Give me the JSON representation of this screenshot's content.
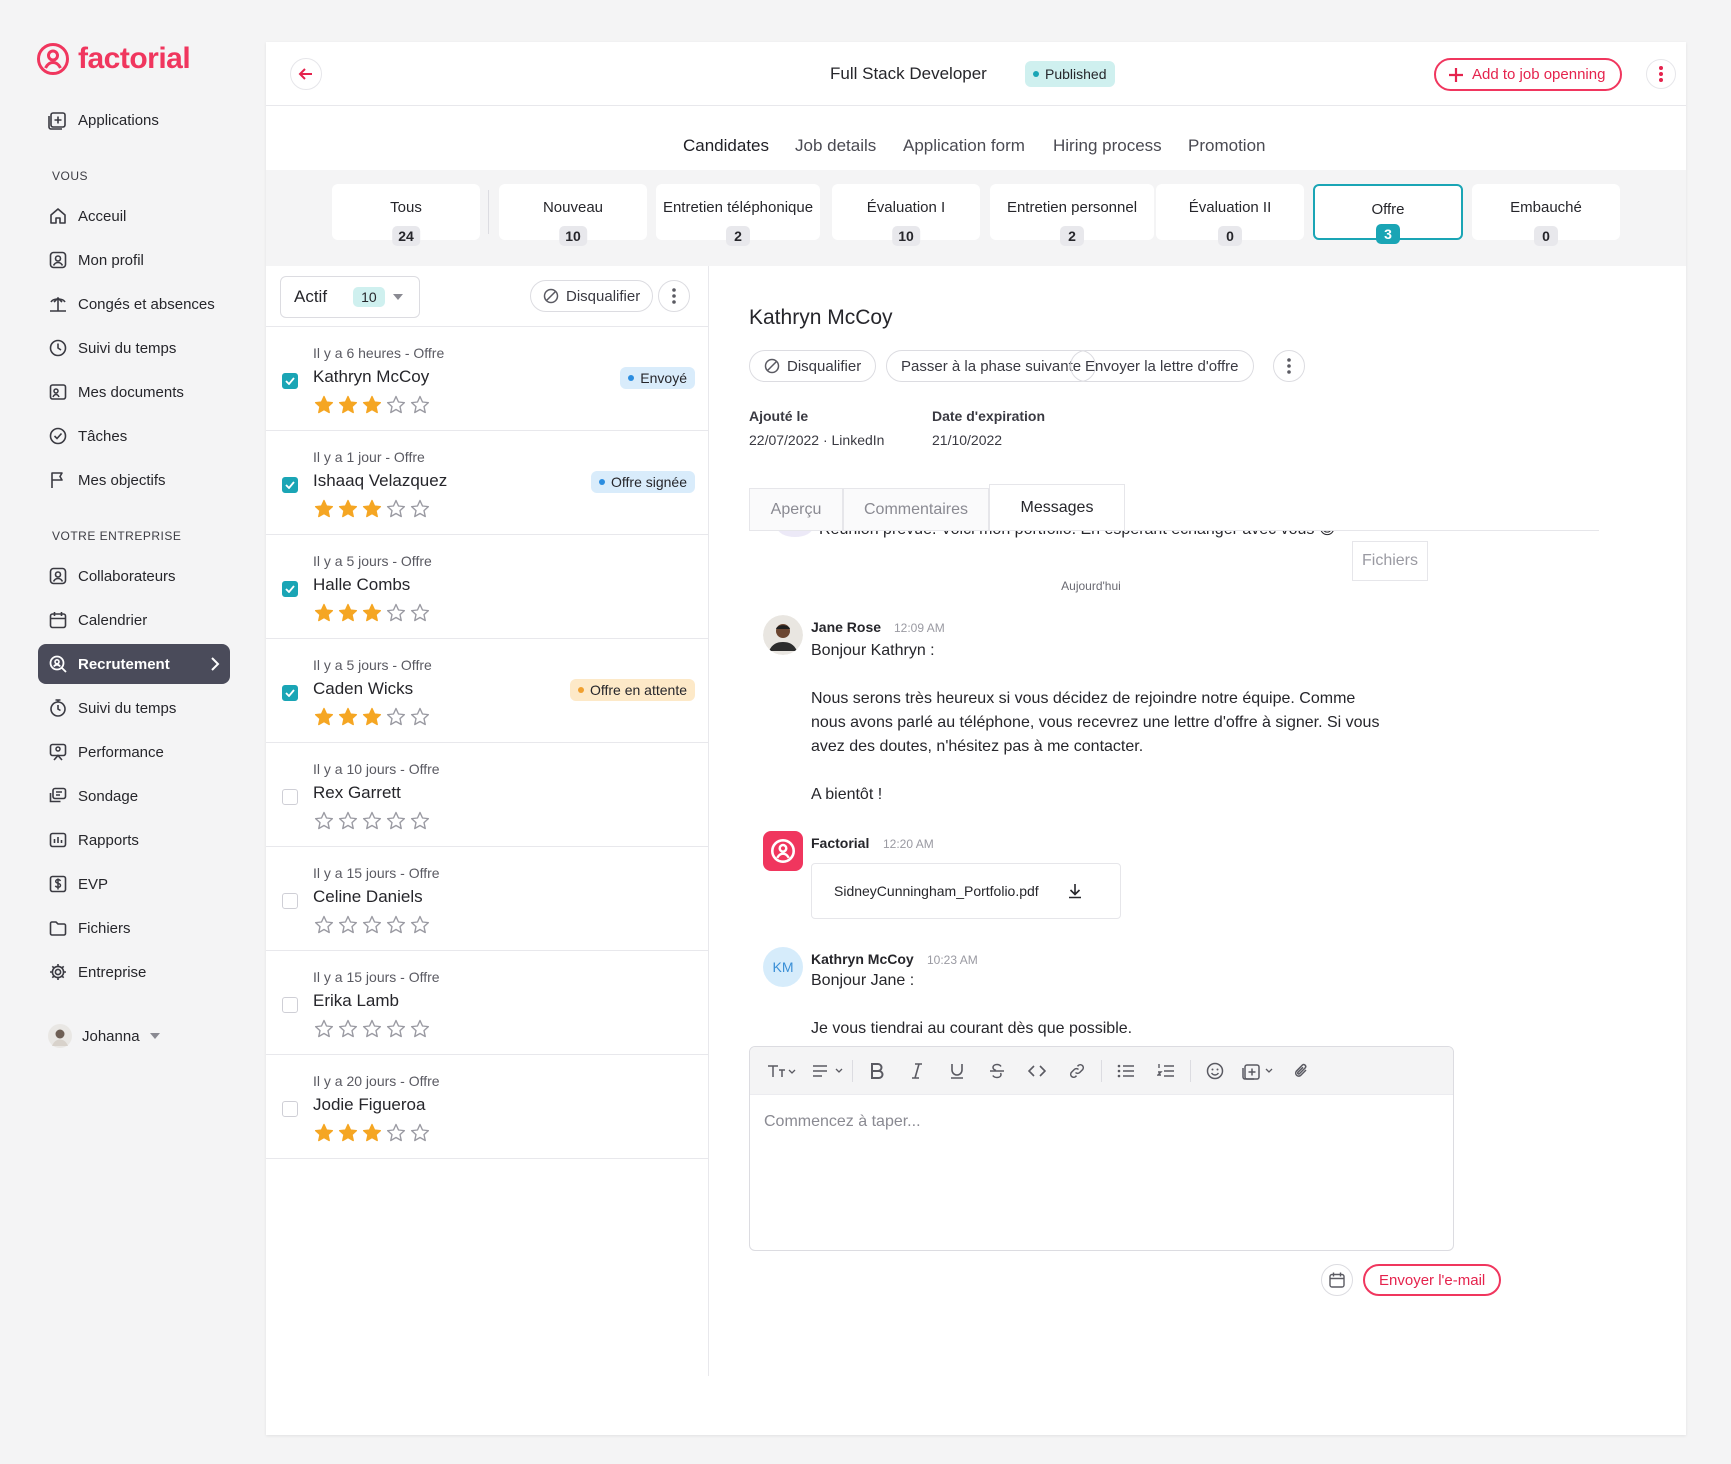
{
  "brand": {
    "name": "factorial",
    "color": "#f0365e"
  },
  "sidebar": {
    "top_item": {
      "label": "Applications",
      "icon": "applications-icon"
    },
    "section_you": "VOUS",
    "you_items": [
      {
        "label": "Acceuil",
        "icon": "home-icon"
      },
      {
        "label": "Mon profil",
        "icon": "profile-icon"
      },
      {
        "label": "Congés et absences",
        "icon": "vacation-icon"
      },
      {
        "label": "Suivi du temps",
        "icon": "clock-icon"
      },
      {
        "label": "Mes documents",
        "icon": "documents-icon"
      },
      {
        "label": "Tâches",
        "icon": "tasks-icon"
      },
      {
        "label": "Mes objectifs",
        "icon": "flag-icon"
      }
    ],
    "section_company": "VOTRE ENTREPRISE",
    "company_items": [
      {
        "label": "Collaborateurs",
        "icon": "employees-icon"
      },
      {
        "label": "Calendrier",
        "icon": "calendar-icon"
      },
      {
        "label": "Recrutement",
        "icon": "recruitment-icon",
        "active": true
      },
      {
        "label": "Suivi du temps",
        "icon": "timer-icon"
      },
      {
        "label": "Performance",
        "icon": "performance-icon"
      },
      {
        "label": "Sondage",
        "icon": "survey-icon"
      },
      {
        "label": "Rapports",
        "icon": "reports-icon"
      },
      {
        "label": "EVP",
        "icon": "payroll-icon"
      },
      {
        "label": "Fichiers",
        "icon": "folder-icon"
      },
      {
        "label": "Entreprise",
        "icon": "gear-icon"
      }
    ],
    "user": {
      "name": "Johanna"
    }
  },
  "header": {
    "job_title": "Full Stack Developer",
    "status": "Published",
    "add_button": "Add to job openning"
  },
  "tabs": [
    "Candidates",
    "Job details",
    "Application form",
    "Hiring process",
    "Promotion"
  ],
  "stages": [
    {
      "name": "Tous",
      "count": "24"
    },
    {
      "name": "Nouveau",
      "count": "10"
    },
    {
      "name": "Entretien téléphonique",
      "count": "2"
    },
    {
      "name": "Évaluation I",
      "count": "10"
    },
    {
      "name": "Entretien personnel",
      "count": "2"
    },
    {
      "name": "Évaluation II",
      "count": "0"
    },
    {
      "name": "Offre",
      "count": "3",
      "selected": true
    },
    {
      "name": "Embauché",
      "count": "0"
    }
  ],
  "list": {
    "filter_label": "Actif",
    "filter_count": "10",
    "disqualify": "Disqualifier",
    "candidates": [
      {
        "meta": "Il y a 6 heures - Offre",
        "name": "Kathryn McCoy",
        "checked": true,
        "rating": 3,
        "badge": "Envoyé",
        "badge_color": "#d9ecfb",
        "dot_color": "#2b8de0"
      },
      {
        "meta": "Il y a 1 jour  - Offre",
        "name": "Ishaaq Velazquez",
        "checked": true,
        "rating": 3,
        "badge": "Offre signée",
        "badge_color": "#d9ecfb",
        "dot_color": "#2b8de0"
      },
      {
        "meta": "Il y a 5 jours  - Offre",
        "name": "Halle Combs",
        "checked": true,
        "rating": 3
      },
      {
        "meta": "Il y a 5 jours  - Offre",
        "name": "Caden Wicks",
        "checked": true,
        "rating": 3,
        "badge": "Offre en attente",
        "badge_color": "#fde9c8",
        "dot_color": "#f0a030"
      },
      {
        "meta": "Il y a 10 jours  - Offre",
        "name": "Rex Garrett",
        "checked": false,
        "rating": 0
      },
      {
        "meta": "Il y a 15 jours  - Offre",
        "name": "Celine Daniels",
        "checked": false,
        "rating": 0
      },
      {
        "meta": "Il y a 15 jours  - Offre",
        "name": "Erika Lamb",
        "checked": false,
        "rating": 0
      },
      {
        "meta": "Il y a 20 jours  - Offre",
        "name": "Jodie Figueroa",
        "checked": false,
        "rating": 3
      }
    ]
  },
  "detail": {
    "name": "Kathryn McCoy",
    "actions": [
      "Disqualifier",
      "Passer à la phase suivante",
      "Envoyer la lettre d'offre"
    ],
    "added_label": "Ajouté le",
    "added_value": "22/07/2022 · LinkedIn",
    "expiry_label": "Date d'expiration",
    "expiry_value": "21/10/2022",
    "tabs": [
      "Aperçu",
      "Commentaires",
      "Messages"
    ],
    "cut_message": "Réunion prévue. Voici mon portfolio. En espérant échanger avec vous 😊",
    "files_tab": "Fichiers",
    "today": "Aujourd'hui",
    "messages": [
      {
        "sender": "Jane Rose",
        "time": "12:09 AM",
        "text": "Bonjour Kathryn :\n\nNous serons très heureux si vous décidez de rejoindre notre équipe. Comme nous avons parlé au téléphone, vous recevrez une lettre d'offre à signer. Si vous avez des doutes, n'hésitez pas à me contacter.\n\nA bientôt !"
      },
      {
        "sender": "Factorial",
        "time": "12:20 AM",
        "file": "SidneyCunningham_Portfolio.pdf"
      },
      {
        "sender": "Kathryn McCoy",
        "initials": "KM",
        "time": "10:23 AM",
        "text": "Bonjour Jane :\n\nJe vous tiendrai au courant dès que possible."
      }
    ],
    "editor_placeholder": "Commencez à taper...",
    "send_button": "Envoyer l'e-mail"
  }
}
